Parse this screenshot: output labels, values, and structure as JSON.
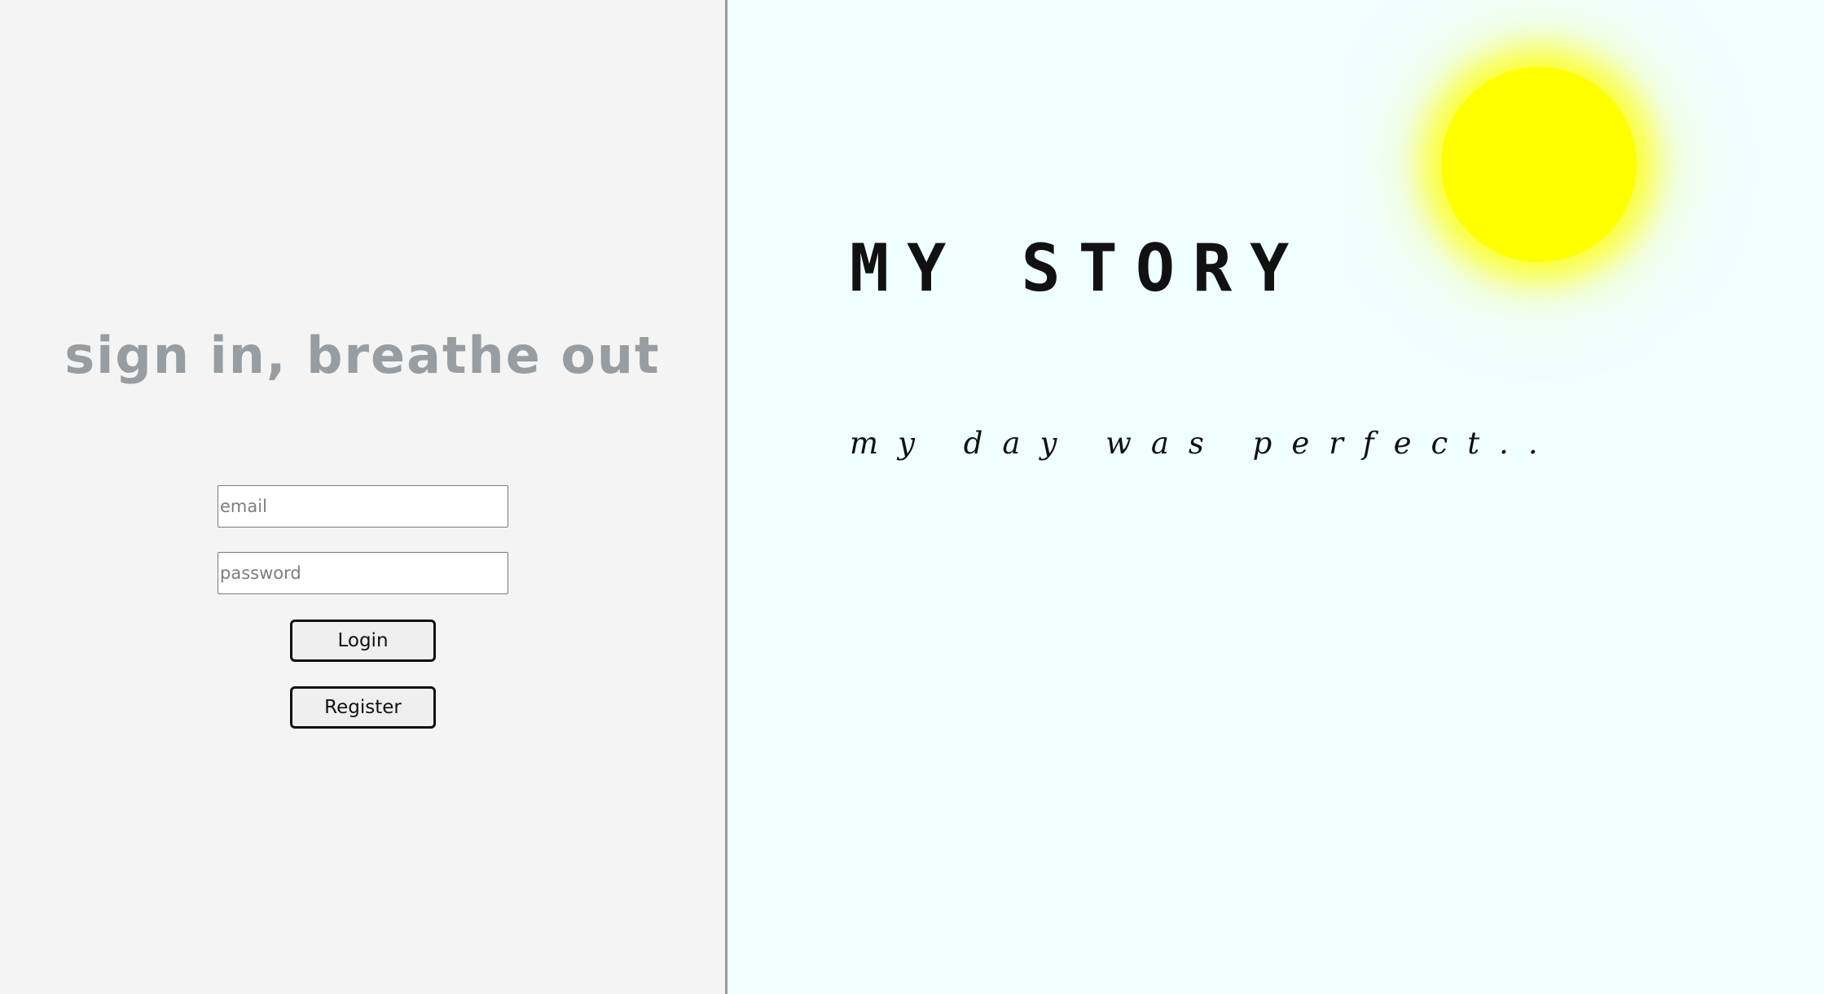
{
  "login": {
    "title": "sign in, breathe out",
    "email_placeholder": "email",
    "password_placeholder": "password",
    "login_label": "Login",
    "register_label": "Register"
  },
  "story": {
    "title": "MY STORY",
    "text": "my day was perfect.."
  },
  "colors": {
    "left_bg": "#f4f4f4",
    "right_bg": "#effefe",
    "title_gray": "#979da1",
    "sun": "#ffff00"
  },
  "icons": {
    "sun": "sun-icon"
  }
}
